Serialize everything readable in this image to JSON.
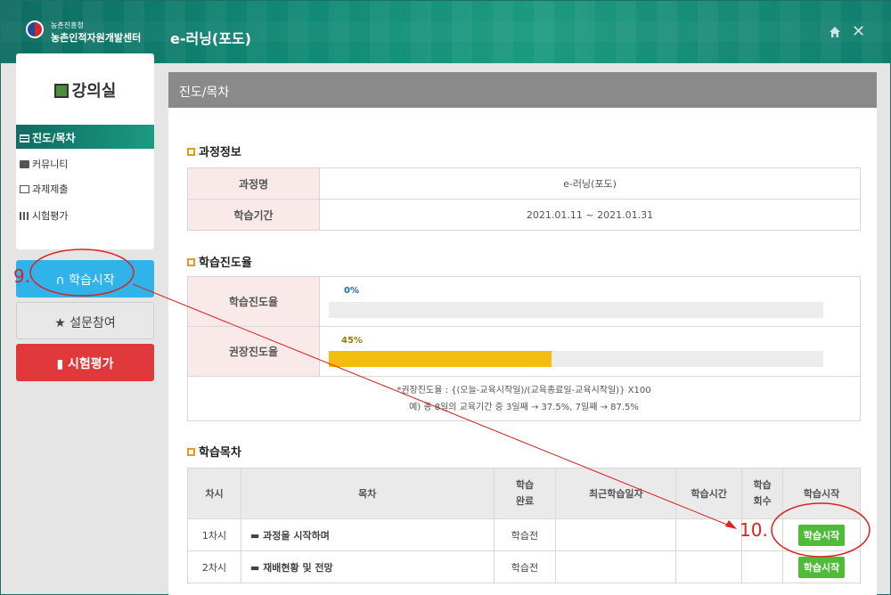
{
  "header": {
    "org_small": "농촌진흥청",
    "org_name": "농촌인적자원개발센터",
    "course_title": "e-러닝(포도)"
  },
  "sidebar": {
    "title": "강의실",
    "menu": [
      {
        "label": "진도/목차",
        "icon": "list-icon"
      },
      {
        "label": "커뮤니티",
        "icon": "chat-icon"
      },
      {
        "label": "과제제출",
        "icon": "monitor-icon"
      },
      {
        "label": "시험평가",
        "icon": "bar-chart-icon"
      }
    ],
    "buttons": {
      "start": "학습시작",
      "survey": "설문참여",
      "exam": "시험평가"
    }
  },
  "main": {
    "header": "진도/목차",
    "course_info": {
      "title": "과정정보",
      "name_label": "과정명",
      "name_value": "e-러닝(포도)",
      "period_label": "학습기간",
      "period_value": "2021.01.11 ~ 2021.01.31"
    },
    "progress": {
      "title": "학습진도율",
      "actual_label": "학습진도율",
      "actual_text": "0%",
      "actual_value": 0,
      "recommended_label": "권장진도율",
      "recommended_text": "45%",
      "recommended_value": 45,
      "note_line1": "*권장진도율 : {(오늘-교육시작일)/(교육종료일-교육시작일)} X100",
      "note_line2": "예) 총 8일의 교육기간 중 3일째 → 37.5%, 7일째 → 87.5%"
    },
    "toc": {
      "title": "학습목차",
      "headers": {
        "session": "차시",
        "contents": "목차",
        "complete_l1": "학습",
        "complete_l2": "완료",
        "recent": "최근학습일자",
        "time": "학습시간",
        "count_l1": "학습",
        "count_l2": "회수",
        "start": "학습시작"
      },
      "rows": [
        {
          "session": "1차시",
          "title": "과정을 시작하며",
          "status": "학습전",
          "recent": "",
          "time": "",
          "count": "",
          "button": "학습시작"
        },
        {
          "session": "2차시",
          "title": "재배현황 및 전망",
          "status": "학습전",
          "recent": "",
          "time": "",
          "count": "",
          "button": "학습시작"
        }
      ]
    }
  },
  "annotations": {
    "step9": "9.",
    "step10": "10."
  },
  "colors": {
    "header_green": "#118a77",
    "start_blue": "#2fb3e8",
    "exam_red": "#e0383b",
    "progress_yellow": "#f3bd0e",
    "button_green": "#4fbb38",
    "annotation_red": "#e02020"
  }
}
